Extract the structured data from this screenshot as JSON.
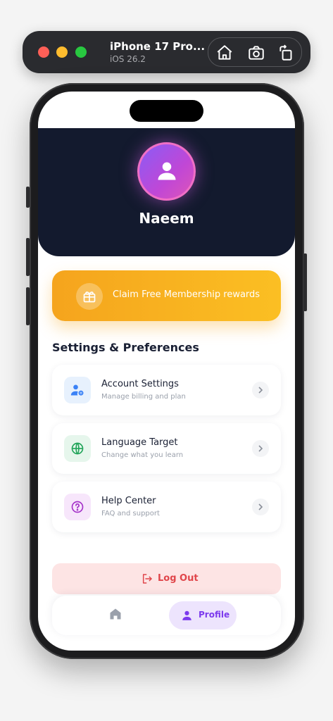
{
  "simulator": {
    "device_name": "iPhone 17 Pro...",
    "os_version": "iOS 26.2",
    "tools": [
      "home-icon",
      "screenshot-icon",
      "rotate-icon"
    ]
  },
  "profile": {
    "name": "Naeem"
  },
  "promo": {
    "label": "Claim Free Membership rewards",
    "icon": "gift-icon"
  },
  "settings": {
    "title": "Settings & Preferences",
    "items": [
      {
        "title": "Account Settings",
        "subtitle": "Manage billing and plan",
        "icon": "user-gear-icon",
        "icon_color": "#3b82f6",
        "icon_bg": "#e7f1fd"
      },
      {
        "title": "Language Target",
        "subtitle": "Change what you learn",
        "icon": "globe-icon",
        "icon_color": "#22a55a",
        "icon_bg": "#e6f6ec"
      },
      {
        "title": "Help Center",
        "subtitle": "FAQ and support",
        "icon": "question-icon",
        "icon_color": "#a533c9",
        "icon_bg": "#f7e6fb"
      }
    ]
  },
  "logout": {
    "label": "Log Out",
    "color": "#e0454a"
  },
  "tabbar": {
    "home_icon": "home-icon",
    "profile_label": "Profile",
    "active_color": "#7c3aed"
  },
  "colors": {
    "hero_bg": "#131a2e",
    "promo_start": "#f5a41d",
    "promo_end": "#fbbf23"
  }
}
